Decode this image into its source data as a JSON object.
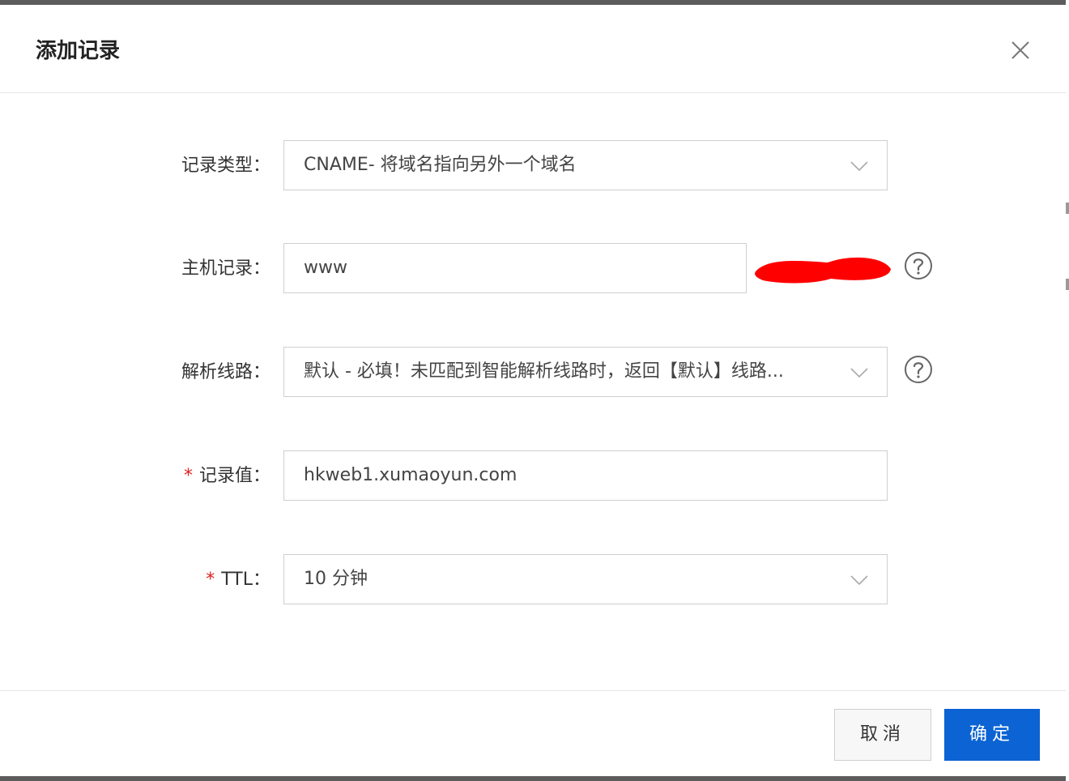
{
  "dialog": {
    "title": "添加记录"
  },
  "form": {
    "record_type": {
      "label": "记录类型：",
      "value": "CNAME- 将域名指向另外一个域名"
    },
    "host": {
      "label": "主机记录：",
      "value": "www"
    },
    "line": {
      "label": "解析线路：",
      "value": "默认 - 必填！未匹配到智能解析线路时，返回【默认】线路..."
    },
    "record_value": {
      "required_mark": "*",
      "label": "记录值：",
      "value": "hkweb1.xumaoyun.com"
    },
    "ttl": {
      "required_mark": "*",
      "label": "TTL：",
      "value": "10 分钟"
    }
  },
  "footer": {
    "cancel_label": "取消",
    "ok_label": "确定"
  },
  "colors": {
    "primary": "#0b63d4",
    "required": "#e02020",
    "redaction": "#ff0000"
  },
  "icons": {
    "close": "close-icon",
    "dropdown": "chevron-down-icon",
    "help": "question-circle-icon"
  }
}
